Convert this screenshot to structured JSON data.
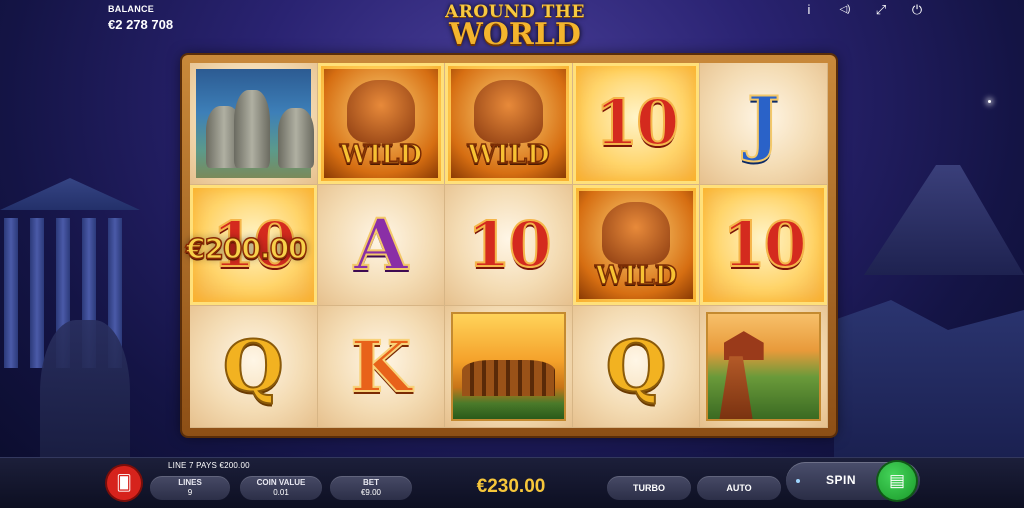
{
  "header": {
    "balance_label": "BALANCE",
    "balance_value": "€2 278 708",
    "logo_line1": "AROUND THE",
    "logo_line2": "WORLD",
    "icons": [
      "info-icon",
      "sound-icon",
      "fullscreen-icon",
      "power-icon"
    ],
    "info_glyph": "i",
    "sound_glyph": "◁)",
    "fullscreen_glyph": "⤢",
    "power_glyph": "⏻"
  },
  "reels": {
    "rows": [
      [
        {
          "symbol": "moai",
          "text": ""
        },
        {
          "symbol": "wild",
          "text": "WILD"
        },
        {
          "symbol": "wild",
          "text": "WILD"
        },
        {
          "symbol": "10",
          "text": "10"
        },
        {
          "symbol": "J",
          "text": "J"
        }
      ],
      [
        {
          "symbol": "10",
          "text": "10"
        },
        {
          "symbol": "A",
          "text": "A"
        },
        {
          "symbol": "10",
          "text": "10"
        },
        {
          "symbol": "wild",
          "text": "WILD"
        },
        {
          "symbol": "10",
          "text": "10"
        }
      ],
      [
        {
          "symbol": "Q",
          "text": "Q"
        },
        {
          "symbol": "K",
          "text": "K"
        },
        {
          "symbol": "colosseum",
          "text": ""
        },
        {
          "symbol": "Q",
          "text": "Q"
        },
        {
          "symbol": "great-wall",
          "text": ""
        }
      ]
    ],
    "win_amount": "€200.00"
  },
  "bottom_bar": {
    "payline_text": "LINE 7 PAYS €200.00",
    "paytable_glyph": "🂠",
    "lines_label": "LINES",
    "lines_value": "9",
    "coin_value_label": "COIN VALUE",
    "coin_value": "0.01",
    "bet_label": "BET",
    "bet_value": "€9.00",
    "total_win": "€230.00",
    "turbo_label": "TURBO",
    "auto_label": "AUTO",
    "spin_label": "SPIN",
    "spin_glyph": "▤"
  },
  "colors": {
    "accent_gold": "#f6c63a",
    "spin_green": "#1a9a2a",
    "paytable_red": "#d6231c"
  }
}
